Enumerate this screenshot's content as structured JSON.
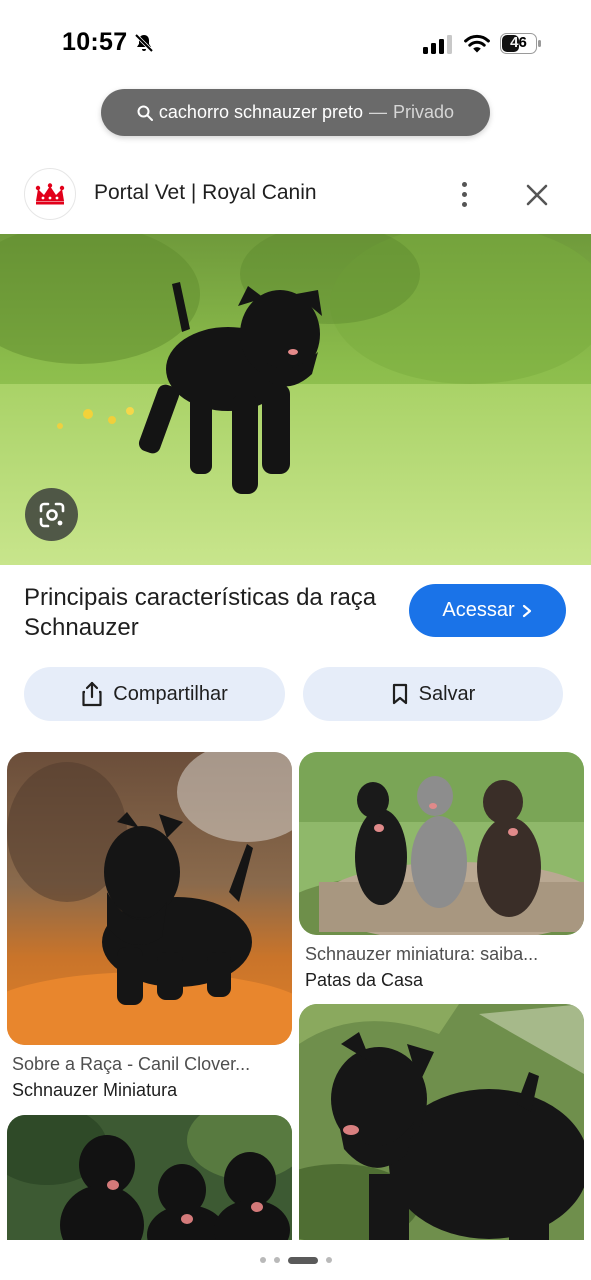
{
  "status_bar": {
    "time": "10:57",
    "battery": "46"
  },
  "search": {
    "query": "cachorro schnauzer preto",
    "separator": "—",
    "mode": "Privado"
  },
  "source": {
    "name": "Portal Vet | Royal Canin",
    "logo_icon": "royal-canin-crown-icon"
  },
  "result": {
    "title": "Principais características da raça Schnauzer",
    "visit_label": "Acessar",
    "share_label": "Compartilhar",
    "save_label": "Salvar"
  },
  "related": [
    {
      "title": "Sobre a Raça - Canil Clover...",
      "source": "Schnauzer Miniatura"
    },
    {
      "title": "Schnauzer miniatura: saiba...",
      "source": "Patas da Casa"
    },
    {
      "title": "",
      "source": ""
    },
    {
      "title": "",
      "source": ""
    }
  ],
  "colors": {
    "accent": "#1a73e8",
    "pill_bg": "#6a6a6a",
    "action_bg": "#e6edf9"
  }
}
